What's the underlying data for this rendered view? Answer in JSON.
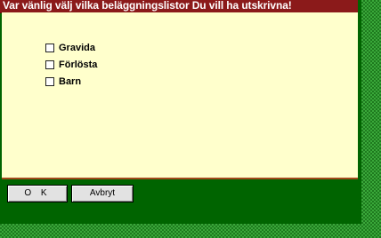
{
  "dialog": {
    "title": "Var vänlig välj vilka beläggningslistor Du vill ha utskrivna!",
    "options": [
      {
        "label": "Gravida",
        "checked": false
      },
      {
        "label": "Förlösta",
        "checked": false
      },
      {
        "label": "Barn",
        "checked": false
      }
    ],
    "buttons": {
      "ok_label": "O K",
      "cancel_label": "Avbryt"
    }
  },
  "colors": {
    "title_bar": "#8b1a1a",
    "content_background": "#ffffcc",
    "footer_background": "#006400"
  }
}
